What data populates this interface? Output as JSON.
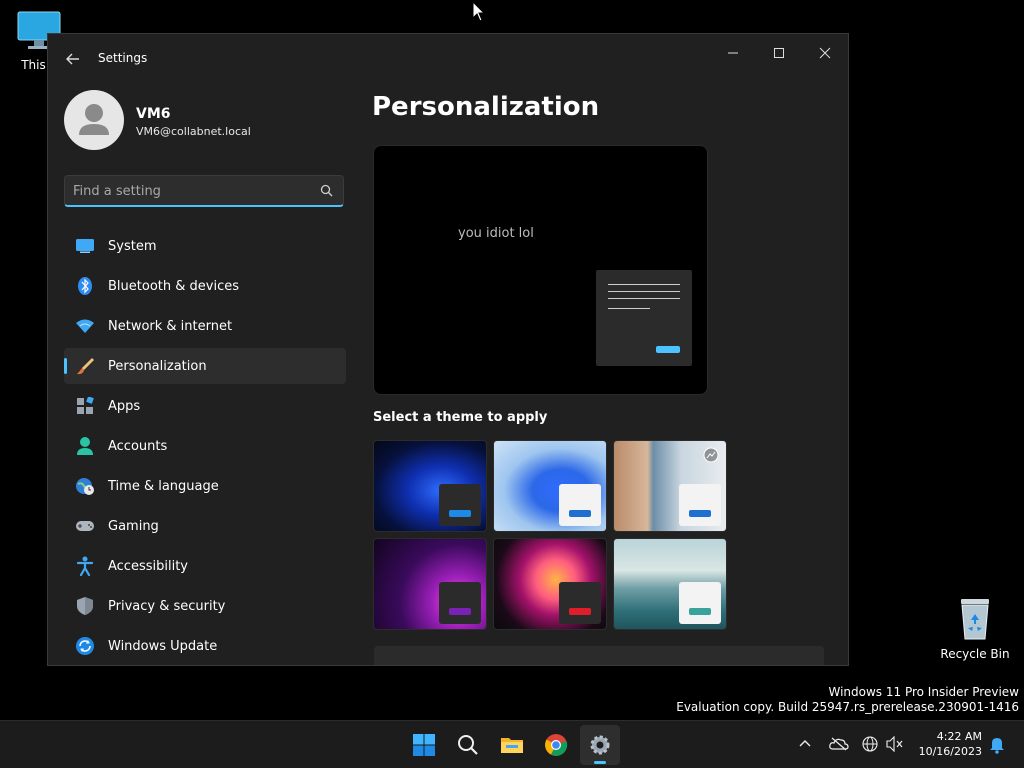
{
  "desktop": {
    "this_pc_label": "This P",
    "recycle_bin_label": "Recycle Bin"
  },
  "window": {
    "title": "Settings"
  },
  "user": {
    "name": "VM6",
    "email": "VM6@collabnet.local"
  },
  "search": {
    "placeholder": "Find a setting"
  },
  "nav": {
    "items": [
      {
        "label": "System",
        "icon": "monitor-icon"
      },
      {
        "label": "Bluetooth & devices",
        "icon": "bluetooth-icon"
      },
      {
        "label": "Network & internet",
        "icon": "wifi-icon"
      },
      {
        "label": "Personalization",
        "icon": "brush-icon",
        "selected": true
      },
      {
        "label": "Apps",
        "icon": "apps-icon"
      },
      {
        "label": "Accounts",
        "icon": "person-icon"
      },
      {
        "label": "Time & language",
        "icon": "globe-clock-icon"
      },
      {
        "label": "Gaming",
        "icon": "gamepad-icon"
      },
      {
        "label": "Accessibility",
        "icon": "accessibility-icon"
      },
      {
        "label": "Privacy & security",
        "icon": "shield-icon"
      },
      {
        "label": "Windows Update",
        "icon": "update-icon"
      }
    ]
  },
  "main": {
    "title": "Personalization",
    "preview_text": "you idiot lol",
    "theme_heading": "Select a theme to apply"
  },
  "watermark": {
    "line1": "Windows 11 Pro Insider Preview",
    "line2": "Evaluation copy. Build 25947.rs_prerelease.230901-1416"
  },
  "taskbar": {
    "time": "4:22 AM",
    "date": "10/16/2023"
  },
  "colors": {
    "accent": "#4cc2ff",
    "window_bg": "#202020",
    "taskbar_bg": "#1c1c1c"
  }
}
